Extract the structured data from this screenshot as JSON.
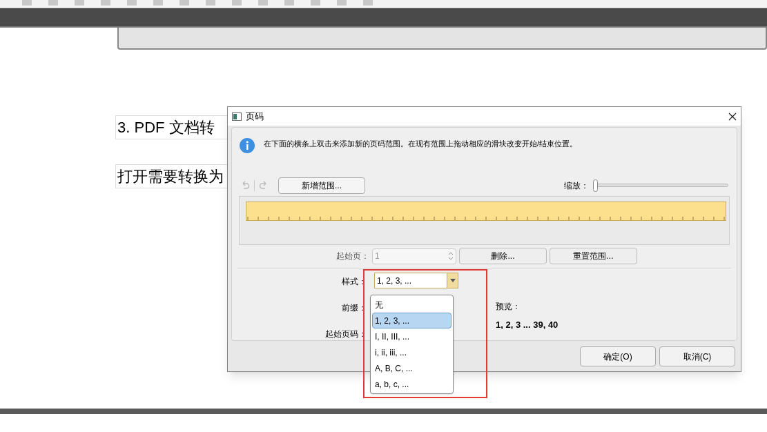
{
  "document": {
    "lines": [
      "3.  PDF 文档转",
      "打开需要转换为"
    ]
  },
  "dialog": {
    "title": "页码",
    "info": "在下面的横条上双击来添加新的页码范围。在现有范围上拖动相应的滑块改变开始/结束位置。",
    "add_range_button": "新增范围...",
    "zoom_label": "缩放：",
    "zoom": {
      "level": 0
    },
    "start_page": {
      "label": "起始页：",
      "value": "1",
      "disabled": true
    },
    "delete_button": "删除...",
    "reset_button": "重置范围...",
    "style": {
      "label": "样式：",
      "value": "1, 2, 3, ...",
      "expanded": true,
      "options": [
        {
          "label": "无",
          "selected": false
        },
        {
          "label": "1, 2, 3, ...",
          "selected": true
        },
        {
          "label": "I, II, III, ...",
          "selected": false
        },
        {
          "label": "i, ii, iii, ...",
          "selected": false
        },
        {
          "label": "A, B, C, ...",
          "selected": false
        },
        {
          "label": "a, b, c, ...",
          "selected": false
        }
      ]
    },
    "prefix_label": "前缀：",
    "start_number_label": "起始页码：",
    "preview_label": "预览：",
    "preview": "1, 2, 3 ... 39, 40",
    "ok_button": "确定(O)",
    "cancel_button": "取消(C)"
  }
}
